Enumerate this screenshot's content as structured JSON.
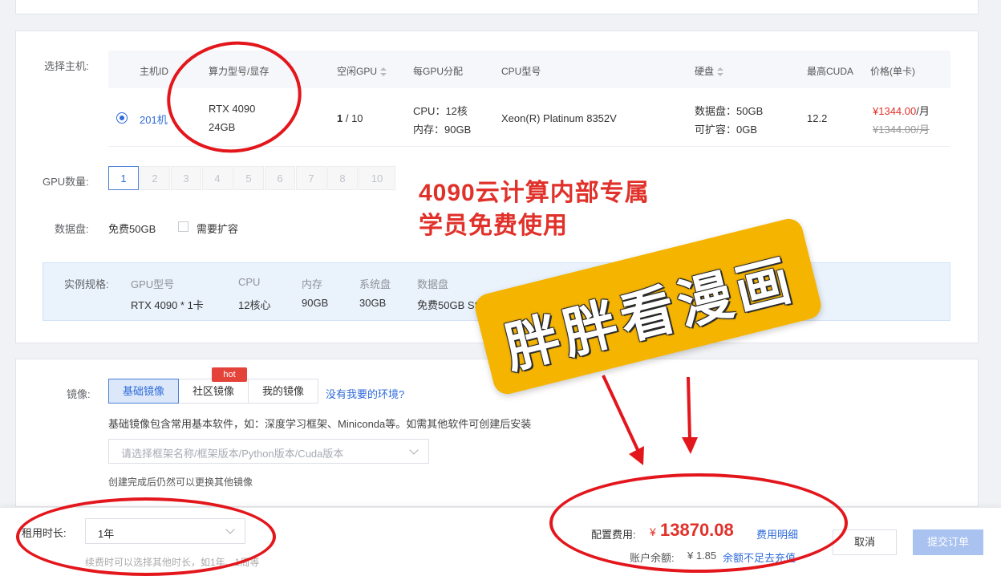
{
  "host": {
    "label": "选择主机:",
    "headers": {
      "id": "主机ID",
      "model": "算力型号/显存",
      "free_gpu": "空闲GPU",
      "per_gpu": "每GPU分配",
      "cpu_model": "CPU型号",
      "disk": "硬盘",
      "cuda": "最高CUDA",
      "price": "价格(单卡)"
    },
    "row": {
      "id": "201机",
      "model": "RTX 4090",
      "vram": "24GB",
      "free_gpu_a": "1",
      "free_gpu_b": " / 10",
      "cpu": "CPU：12核",
      "mem": "内存：90GB",
      "cpu_model": "Xeon(R) Platinum 8352V",
      "disk_data": "数据盘：50GB",
      "disk_ext": "可扩容：0GB",
      "cuda": "12.2",
      "price": "¥1344.00",
      "price_unit": "/月",
      "price_orig": "¥1344.00/月"
    }
  },
  "gpu_count": {
    "label": "GPU数量:",
    "options": [
      "1",
      "2",
      "3",
      "4",
      "5",
      "6",
      "7",
      "8",
      "10"
    ],
    "selected": "1"
  },
  "data_disk": {
    "label": "数据盘:",
    "value": "免费50GB",
    "expand_label": "需要扩容"
  },
  "spec": {
    "label": "实例规格:",
    "cols": [
      {
        "title": "GPU型号",
        "value": "RTX 4090 * 1卡"
      },
      {
        "title": "CPU",
        "value": "12核心"
      },
      {
        "title": "内存",
        "value": "90GB"
      },
      {
        "title": "系统盘",
        "value": "30GB"
      },
      {
        "title": "数据盘",
        "value": "免费50GB SS"
      }
    ]
  },
  "annotation": {
    "line1": "4090云计算内部专属",
    "line2": "学员免费使用"
  },
  "watermark": {
    "text": "胖胖看漫画",
    "color": "#f5b400"
  },
  "image": {
    "label": "镜像:",
    "tabs": [
      "基础镜像",
      "社区镜像",
      "我的镜像"
    ],
    "hot_badge": "hot",
    "no_env_link": "没有我要的环境?",
    "desc": "基础镜像包含常用基本软件，如：深度学习框架、Miniconda等。如需其他软件可创建后安装",
    "select_placeholder": "请选择框架名称/框架版本/Python版本/Cuda版本",
    "note": "创建完成后仍然可以更换其他镜像"
  },
  "footer": {
    "duration_label": "租用时长:",
    "duration_value": "1年",
    "duration_note": "续费时可以选择其他时长，如1年、1周等",
    "fee_label": "配置费用:",
    "fee_currency": "¥",
    "fee_value": "13870.08",
    "fee_detail": "费用明细",
    "balance_label": "账户余额:",
    "balance_value": "¥ 1.85",
    "balance_link": "余额不足去充值",
    "cancel": "取消",
    "submit": "提交订单"
  },
  "colors": {
    "accent": "#2f6bd9",
    "price_red": "#e0312a",
    "annotation_red": "#e3161c",
    "submit_bg": "#a9c2f0"
  }
}
